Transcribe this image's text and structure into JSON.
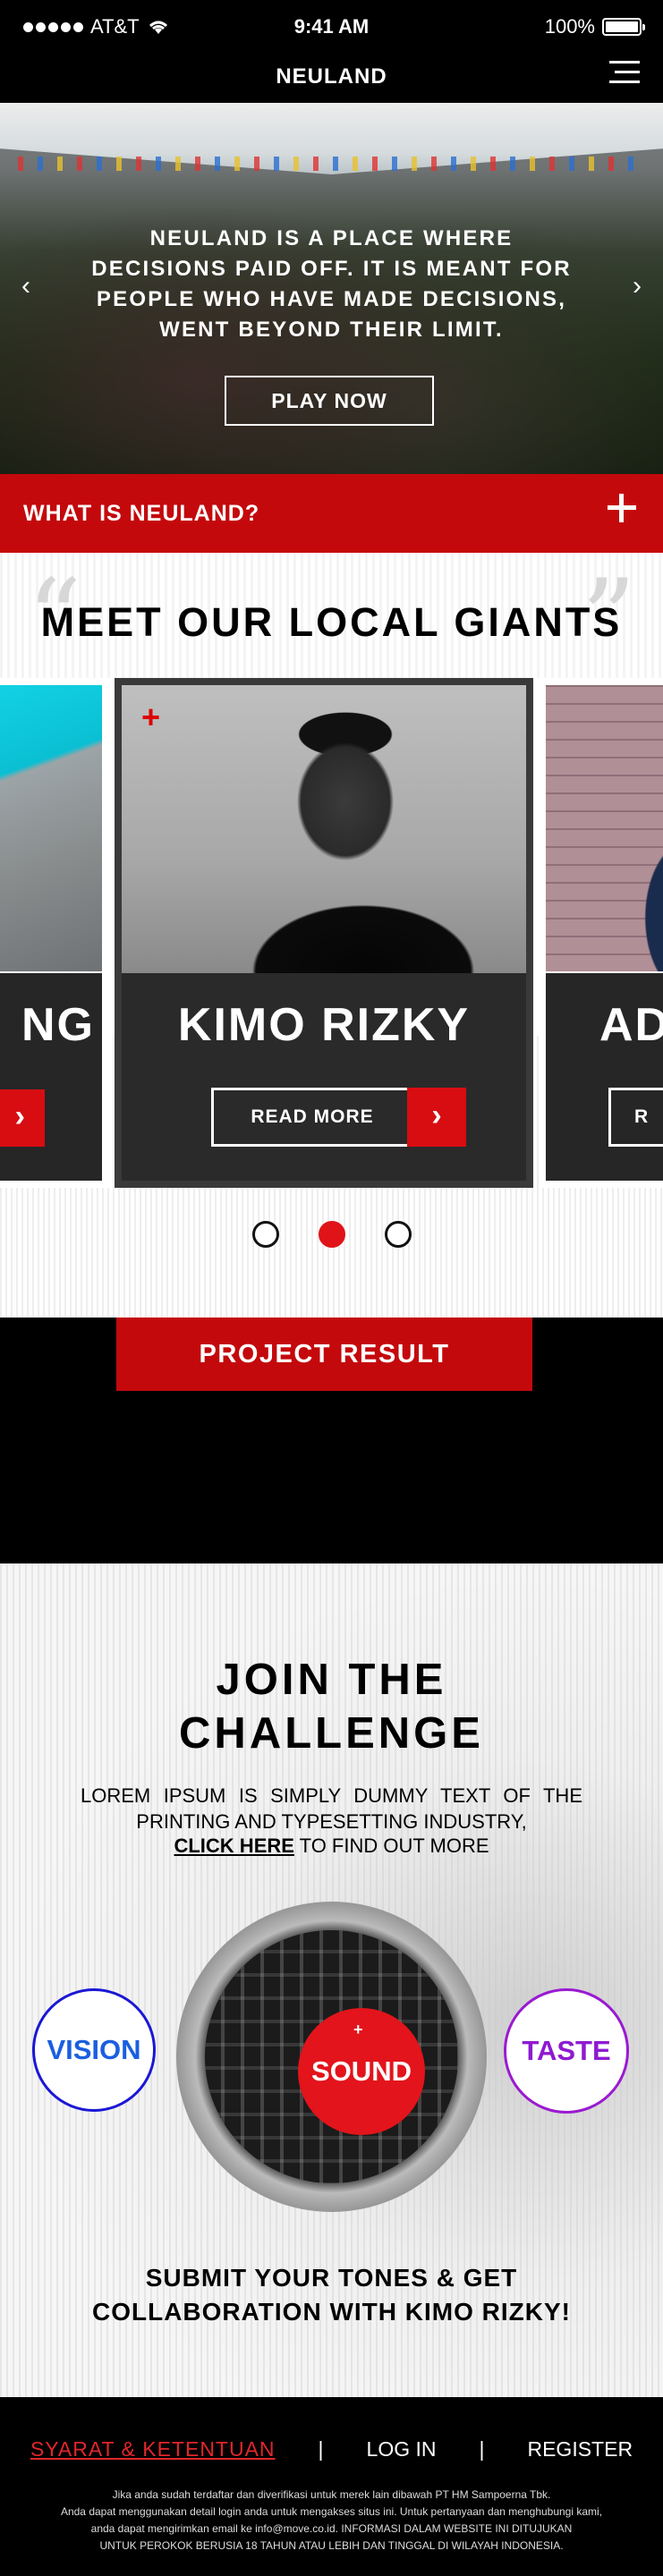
{
  "status_bar": {
    "carrier": "AT&T",
    "time": "9:41 AM",
    "battery": "100%"
  },
  "nav": {
    "brand": "NEULAND",
    "menu_icon": "hamburger-icon"
  },
  "hero": {
    "text": "NEULAND IS A PLACE WHERE DECISIONS PAID OFF. IT IS MEANT FOR PEOPLE WHO HAVE MADE DECISIONS, WENT BEYOND THEIR LIMIT.",
    "play_label": "PLAY NOW",
    "prev_icon": "chevron-left-icon",
    "next_icon": "chevron-right-icon"
  },
  "accordion": {
    "label": "WHAT IS NEULAND?",
    "icon": "plus-icon"
  },
  "giants": {
    "title": "MEET OUR LOCAL GIANTS",
    "cards": [
      {
        "name": "NG"
      },
      {
        "name": "KIMO RIZKY",
        "read_more": "READ MORE"
      },
      {
        "name": "AD",
        "read_more": "R"
      }
    ],
    "active_dot": 1
  },
  "project": {
    "label": "PROJECT RESULT"
  },
  "challenge": {
    "title_line1": "JOIN THE",
    "title_line2": "CHALLENGE",
    "text": "LOREM IPSUM IS SIMPLY DUMMY TEXT OF THE PRINTING AND TYPESETTING INDUSTRY,",
    "link": "CLICK HERE",
    "link_suffix": " TO FIND OUT MORE",
    "vision": "VISION",
    "sound": "SOUND",
    "taste": "TASTE",
    "submit_line1": "SUBMIT YOUR TONES & GET",
    "submit_line2": "COLLABORATION WITH KIMO RIZKY!",
    "colors": {
      "vision": "#1a5fe0",
      "sound": "#e3141b",
      "taste": "#8f1ad1"
    }
  },
  "footer": {
    "terms": "SYARAT & KETENTUAN",
    "login": "LOG IN",
    "register": "REGISTER",
    "separator": "|",
    "disclaimer_1": "Jika anda sudah terdaftar dan diverifikasi untuk merek lain dibawah PT HM Sampoerna Tbk.",
    "disclaimer_2": "Anda dapat menggunakan detail login anda untuk mengakses situs ini. Untuk pertanyaan dan menghubungi kami,",
    "disclaimer_3": "anda dapat mengirimkan email ke info@move.co.id. INFORMASI DALAM WEBSITE INI DITUJUKAN",
    "disclaimer_4": "UNTUK PEROKOK BERUSIA 18 TAHUN ATAU LEBIH DAN TINGGAL DI WILAYAH INDONESIA."
  },
  "accent_color": "#c4090c"
}
